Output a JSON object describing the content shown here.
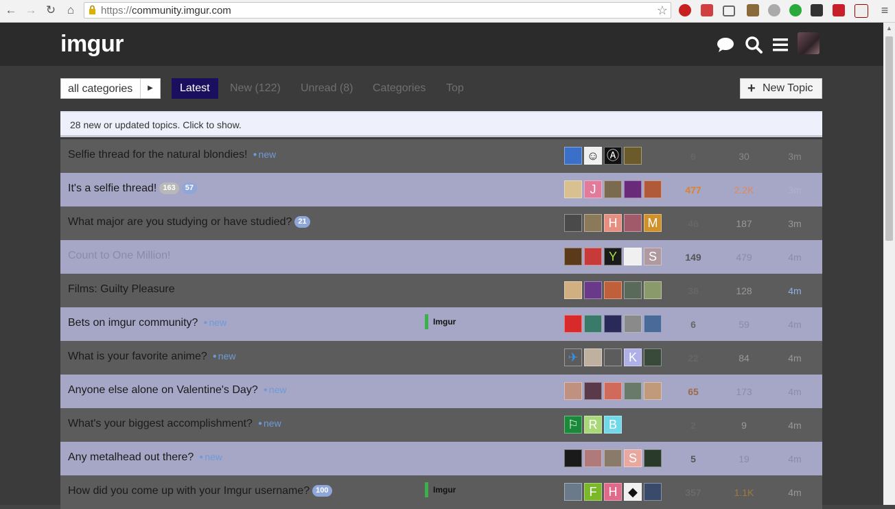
{
  "browser": {
    "url_scheme": "https://",
    "url_host": "community.imgur.com"
  },
  "site": {
    "logo_text": "imgur",
    "accent": "#85bf25"
  },
  "header_icons": [
    "chat-icon",
    "search-icon",
    "hamburger-menu-icon",
    "user-avatar"
  ],
  "nav": {
    "category_label": "all categories",
    "items": [
      {
        "label": "Latest"
      },
      {
        "label": "New (122)"
      },
      {
        "label": "Unread (8)"
      },
      {
        "label": "Categories"
      },
      {
        "label": "Top"
      }
    ],
    "new_topic_label": "New Topic"
  },
  "banner_text": "28 new or updated topics. Click to show.",
  "topics": [
    {
      "title": "Selfie thread for the natural blondies!",
      "new": "new",
      "replies": "6",
      "views": "30",
      "activity": "3m",
      "replies_color": "#666",
      "views_color": "#888",
      "activity_color": "#888",
      "avatars": [
        {
          "bg": "#3a70c8"
        },
        {
          "bg": "#f0f0f0",
          "fg": "#222",
          "glyph": "☺"
        },
        {
          "bg": "#111",
          "glyph": "Ⓐ"
        },
        {
          "bg": "#6b5a2a"
        }
      ]
    },
    {
      "title": "It's a selfie thread!",
      "badges": [
        {
          "text": "163",
          "kind": "grey"
        },
        {
          "text": "57",
          "kind": "blue"
        }
      ],
      "replies": "477",
      "views": "2.2K",
      "activity": "3m",
      "replies_color": "#e0822a",
      "views_color": "#e08a5a",
      "activity_color": "#b0b0d0",
      "avatars": [
        {
          "bg": "#d8c090"
        },
        {
          "bg": "#e27a9a",
          "glyph": "J"
        },
        {
          "bg": "#7a6a50"
        },
        {
          "bg": "#6a2a7a"
        },
        {
          "bg": "#b05a3a"
        }
      ]
    },
    {
      "title": "What major are you studying or have studied?",
      "badges": [
        {
          "text": "21",
          "kind": "blue"
        }
      ],
      "replies": "46",
      "views": "187",
      "activity": "3m",
      "replies_color": "#666",
      "views_color": "#999",
      "activity_color": "#999",
      "avatars": [
        {
          "bg": "#4a4a4a"
        },
        {
          "bg": "#8a7a5a"
        },
        {
          "bg": "#e68e80",
          "glyph": "H"
        },
        {
          "bg": "#a05a6a"
        },
        {
          "bg": "#d0902a",
          "glyph": "M"
        }
      ]
    },
    {
      "title": "Count to One Million!",
      "muted": true,
      "replies": "149",
      "views": "479",
      "activity": "4m",
      "replies_color": "#555",
      "views_color": "#8a8aaa",
      "activity_color": "#8a8aaa",
      "avatars": [
        {
          "bg": "#5a3a1a"
        },
        {
          "bg": "#c83a3a"
        },
        {
          "bg": "#1a1a1a",
          "fg": "#a8e040",
          "glyph": "Y"
        },
        {
          "bg": "#f0f0f0"
        },
        {
          "bg": "#b09aa0",
          "glyph": "S"
        }
      ]
    },
    {
      "title": "Films: Guilty Pleasure",
      "replies": "38",
      "views": "128",
      "activity": "4m",
      "replies_color": "#666",
      "views_color": "#999",
      "activity_color": "#8fb0e8",
      "avatars": [
        {
          "bg": "#d0b080"
        },
        {
          "bg": "#6a3a8a"
        },
        {
          "bg": "#c0603a"
        },
        {
          "bg": "#5a6a5a"
        },
        {
          "bg": "#8a9a6a"
        }
      ]
    },
    {
      "title": "Bets on imgur community?",
      "new": "new",
      "category": "Imgur",
      "replies": "6",
      "views": "59",
      "activity": "4m",
      "replies_color": "#666",
      "views_color": "#8a8aaa",
      "activity_color": "#8a8aaa",
      "avatars": [
        {
          "bg": "#d82a2a"
        },
        {
          "bg": "#3a7a6a"
        },
        {
          "bg": "#2a2a5a"
        },
        {
          "bg": "#8a8a8a"
        },
        {
          "bg": "#4a6a9a"
        }
      ]
    },
    {
      "title": "What is your favorite anime?",
      "new": "new",
      "replies": "22",
      "views": "84",
      "activity": "4m",
      "replies_color": "#666",
      "views_color": "#999",
      "activity_color": "#999",
      "avatars": [
        {
          "bg": "#5c5c5c",
          "fg": "#3a90e0",
          "glyph": "✈"
        },
        {
          "bg": "#c0b0a0"
        },
        {
          "bg": "#5c5c5c"
        },
        {
          "bg": "#b0b0e8",
          "glyph": "K"
        },
        {
          "bg": "#3a4a3a"
        }
      ]
    },
    {
      "title": "Anyone else alone on Valentine's Day?",
      "new": "new",
      "replies": "65",
      "views": "173",
      "activity": "4m",
      "replies_color": "#9a6a4a",
      "views_color": "#8a8aaa",
      "activity_color": "#8a8aaa",
      "avatars": [
        {
          "bg": "#c09080"
        },
        {
          "bg": "#5a3a4a"
        },
        {
          "bg": "#d06a5a"
        },
        {
          "bg": "#6a7a6a"
        },
        {
          "bg": "#c09a7a"
        }
      ]
    },
    {
      "title": "What's your biggest accomplishment?",
      "new": "new",
      "replies": "2",
      "views": "9",
      "activity": "4m",
      "replies_color": "#666",
      "views_color": "#999",
      "activity_color": "#999",
      "avatars": [
        {
          "bg": "#1a8a3a",
          "glyph": "⚐"
        },
        {
          "bg": "#a8d878",
          "glyph": "R"
        },
        {
          "bg": "#70d8e8",
          "glyph": "B"
        }
      ]
    },
    {
      "title": "Any metalhead out there?",
      "new": "new",
      "replies": "5",
      "views": "19",
      "activity": "4m",
      "replies_color": "#555",
      "views_color": "#8a8aaa",
      "activity_color": "#8a8aaa",
      "avatars": [
        {
          "bg": "#1a1a1a"
        },
        {
          "bg": "#b07a7a"
        },
        {
          "bg": "#8a7a6a"
        },
        {
          "bg": "#e8a8a0",
          "glyph": "S"
        },
        {
          "bg": "#2a3a2a"
        }
      ]
    },
    {
      "title": "How did you come up with your Imgur username?",
      "badges": [
        {
          "text": "100",
          "kind": "blue"
        }
      ],
      "category": "Imgur",
      "replies": "357",
      "views": "1.1K",
      "activity": "4m",
      "replies_color": "#6a6a6a",
      "views_color": "#a07a3a",
      "activity_color": "#999",
      "avatars": [
        {
          "bg": "#6a7a8a"
        },
        {
          "bg": "#7ab82a",
          "glyph": "F"
        },
        {
          "bg": "#e06a8a",
          "glyph": "H"
        },
        {
          "bg": "#f0f0f0",
          "fg": "#111",
          "glyph": "◆"
        },
        {
          "bg": "#3a4a6a"
        }
      ]
    }
  ]
}
